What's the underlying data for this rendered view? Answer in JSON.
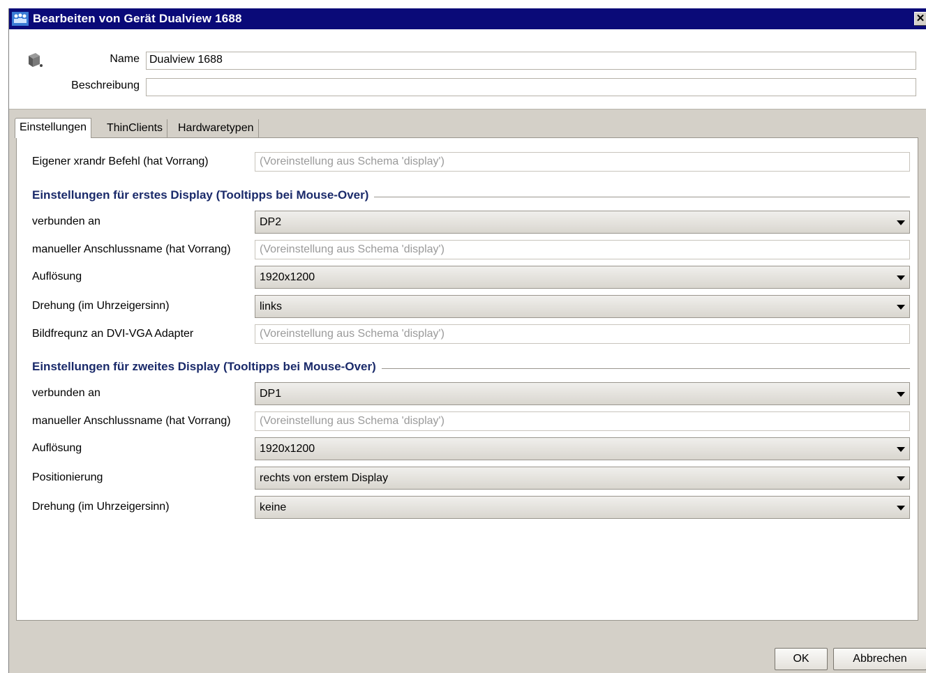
{
  "window": {
    "title": "Bearbeiten von Gerät Dualview 1688",
    "close_glyph": "✕"
  },
  "header": {
    "name_label": "Name",
    "name_value": "Dualview 1688",
    "description_label": "Beschreibung",
    "description_value": ""
  },
  "tabs": [
    {
      "label": "Einstellungen",
      "active": true
    },
    {
      "label": "ThinClients",
      "active": false
    },
    {
      "label": "Hardwaretypen",
      "active": false
    }
  ],
  "settings": {
    "xrandr_label": "Eigener xrandr Befehl (hat Vorrang)",
    "xrandr_placeholder": "(Voreinstellung aus Schema 'display')",
    "display1": {
      "title": "Einstellungen für erstes Display (Tooltipps bei Mouse-Over)",
      "connected_label": "verbunden an",
      "connected_value": "DP2",
      "manual_name_label": "manueller Anschlussname (hat Vorrang)",
      "manual_name_placeholder": "(Voreinstellung aus Schema 'display')",
      "resolution_label": "Auflösung",
      "resolution_value": "1920x1200",
      "rotation_label": "Drehung (im Uhrzeigersinn)",
      "rotation_value": "links",
      "refresh_label": "Bildfrequnz an DVI-VGA Adapter",
      "refresh_placeholder": "(Voreinstellung aus Schema 'display')"
    },
    "display2": {
      "title": "Einstellungen für zweites Display (Tooltipps bei Mouse-Over)",
      "connected_label": "verbunden an",
      "connected_value": "DP1",
      "manual_name_label": "manueller Anschlussname (hat Vorrang)",
      "manual_name_placeholder": "(Voreinstellung aus Schema 'display')",
      "resolution_label": "Auflösung",
      "resolution_value": "1920x1200",
      "position_label": "Positionierung",
      "position_value": "rechts von erstem Display",
      "rotation_label": "Drehung (im Uhrzeigersinn)",
      "rotation_value": "keine"
    }
  },
  "footer": {
    "ok_label": "OK",
    "cancel_label": "Abbrechen"
  },
  "icons": {
    "app": "users-group-icon",
    "device": "thin-client-device-icon",
    "dropdown": "chevron-down-icon"
  },
  "colors": {
    "titlebar": "#0a0a78",
    "section_title": "#1a2a6a",
    "dialog_bg": "#d4d0c8"
  }
}
